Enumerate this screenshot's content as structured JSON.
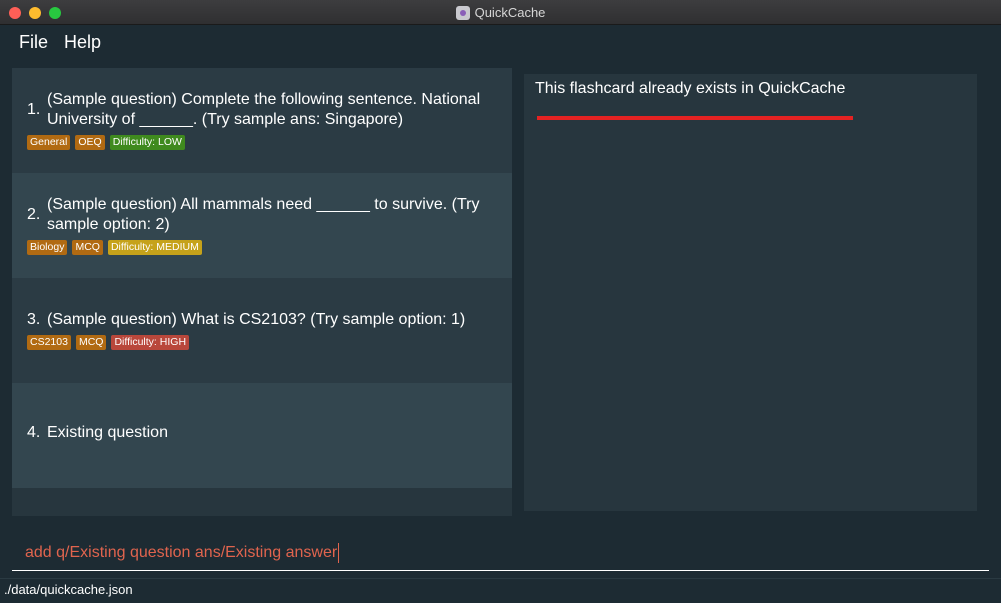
{
  "window": {
    "title": "QuickCache"
  },
  "menu": {
    "file": "File",
    "help": "Help"
  },
  "flashcards": [
    {
      "number": "1.",
      "question": "(Sample question) Complete the following sentence. National University of ______. (Try sample ans: Singapore)",
      "tags": [
        "General",
        "OEQ"
      ],
      "difficulty": "Difficulty: LOW"
    },
    {
      "number": "2.",
      "question": "(Sample question) All mammals need ______ to survive. (Try sample option: 2)",
      "tags": [
        "Biology",
        "MCQ"
      ],
      "difficulty": "Difficulty: MEDIUM"
    },
    {
      "number": "3.",
      "question": "(Sample question) What is CS2103? (Try sample option: 1)",
      "tags": [
        "CS2103",
        "MCQ"
      ],
      "difficulty": "Difficulty: HIGH"
    },
    {
      "number": "4.",
      "question": "Existing question"
    }
  ],
  "result": {
    "message": "This flashcard already exists in QuickCache",
    "status_color": "#e52222"
  },
  "command": {
    "value": "add q/Existing question ans/Existing answer"
  },
  "status": {
    "path": "./data/quickcache.json"
  },
  "colors": {
    "tag_orange": "#b16a12",
    "difficulty_low": "#3f8a1e",
    "difficulty_medium": "#c6a21a",
    "difficulty_high": "#b9473b",
    "command_text": "#e0644e"
  },
  "icons": [
    "close-window-icon",
    "minimize-window-icon",
    "zoom-window-icon",
    "quickcache-app-icon"
  ]
}
